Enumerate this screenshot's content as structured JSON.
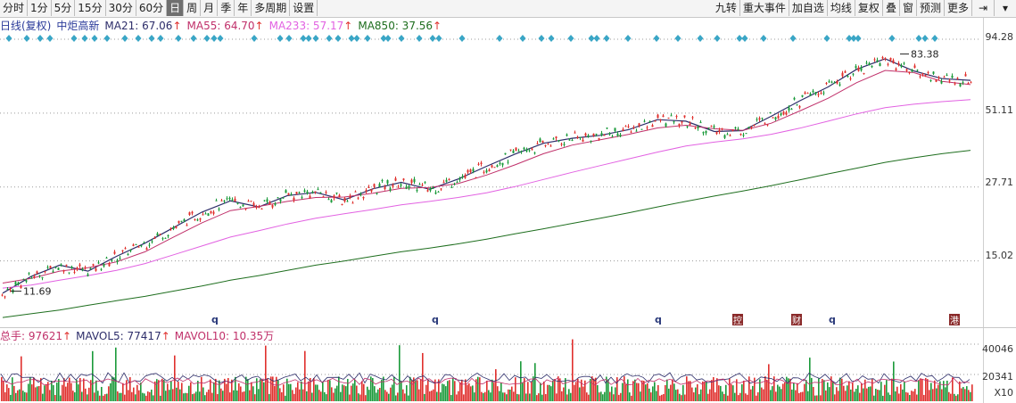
{
  "toolbar": {
    "left": [
      "分时",
      "1分",
      "5分",
      "15分",
      "30分",
      "60分",
      "日",
      "周",
      "月",
      "季",
      "年",
      "多周期",
      "设置"
    ],
    "active": "日",
    "right": [
      "九转",
      "重大事件",
      "加自选",
      "均线",
      "复权",
      "叠",
      "窗",
      "预测",
      "更多"
    ]
  },
  "info": {
    "title": "日线(复权)",
    "name": "中炬高新",
    "ma21": "MA21: 67.06",
    "ma55": "MA55: 64.70",
    "ma233": "MA233: 57.17",
    "ma850": "MA850: 37.56",
    "arrow": "↑"
  },
  "price_axis": [
    "94.28",
    "51.11",
    "27.71",
    "15.02"
  ],
  "annotations": {
    "high": "83.38",
    "low": "11.69",
    "events": [
      "q",
      "q",
      "q",
      "控",
      "财",
      "q",
      "港"
    ]
  },
  "volume": {
    "total_label": "总手: 97621",
    "mavol5": "MAVOL5: 77417",
    "mavol10": "MAVOL10: 10.35万",
    "axis": [
      "40046",
      "20341"
    ],
    "unit": "X10"
  },
  "colors": {
    "up": "#e0302d",
    "down": "#1a9a3a",
    "ma21": "#2d2d6a",
    "ma55": "#c0306a",
    "ma233": "#e262e2",
    "ma850": "#1e6e1e",
    "diamond": "#3aa6c6"
  },
  "chart_data": {
    "type": "line",
    "title": "中炬高新",
    "ylim": [
      9,
      100
    ],
    "scale": "log",
    "series": [
      {
        "name": "MA21",
        "values": [
          11.5,
          13.2,
          14.5,
          13.8,
          15.6,
          17.4,
          19.8,
          22.5,
          24.7,
          23.5,
          25.8,
          26.5,
          24.9,
          27.3,
          28.8,
          27.2,
          29.6,
          32.9,
          36.4,
          39.8,
          41.5,
          42.5,
          44.6,
          48.4,
          47.8,
          43.9,
          44.2,
          49.8,
          56.6,
          63.5,
          73.5,
          80.2,
          72.5,
          68.0,
          67.06
        ]
      },
      {
        "name": "MA55",
        "values": [
          12.5,
          13.0,
          13.8,
          14.2,
          14.9,
          16.2,
          18.3,
          20.6,
          22.8,
          23.6,
          24.6,
          25.4,
          25.5,
          26.3,
          27.4,
          27.6,
          28.5,
          30.6,
          33.3,
          36.5,
          39.2,
          41.0,
          42.9,
          45.2,
          46.2,
          44.9,
          44.3,
          47.0,
          52.0,
          57.8,
          65.8,
          72.8,
          71.5,
          66.5,
          64.7
        ]
      },
      {
        "name": "MA233",
        "values": [
          12.0,
          12.3,
          12.8,
          13.3,
          13.9,
          14.7,
          15.8,
          17.0,
          18.3,
          19.3,
          20.4,
          21.4,
          22.2,
          23.0,
          23.9,
          24.6,
          25.4,
          26.4,
          27.8,
          29.5,
          31.3,
          33.1,
          35.0,
          37.0,
          38.9,
          40.2,
          41.3,
          42.9,
          45.1,
          47.8,
          50.8,
          53.5,
          55.0,
          56.2,
          57.17
        ]
      },
      {
        "name": "MA850",
        "values": [
          9.4,
          9.7,
          10.0,
          10.4,
          10.8,
          11.2,
          11.7,
          12.2,
          12.8,
          13.3,
          13.9,
          14.5,
          15.0,
          15.6,
          16.2,
          16.7,
          17.3,
          18.0,
          18.8,
          19.6,
          20.5,
          21.4,
          22.4,
          23.5,
          24.6,
          25.7,
          26.8,
          28.0,
          29.4,
          30.9,
          32.4,
          34.0,
          35.3,
          36.5,
          37.56
        ]
      }
    ]
  }
}
